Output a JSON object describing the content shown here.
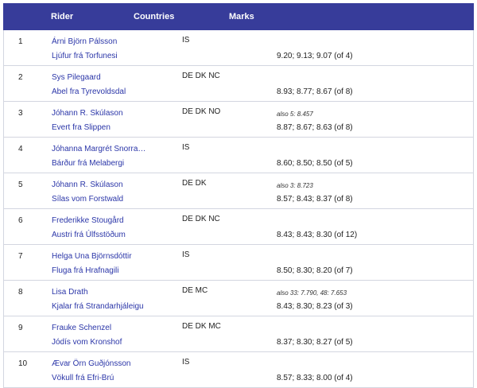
{
  "header": {
    "rider": "Rider",
    "countries": "Countries",
    "marks": "Marks"
  },
  "rows": [
    {
      "rank": "1",
      "rider": "Árni Björn Pálsson",
      "horse": "Ljúfur frá Torfunesi",
      "countries": "IS",
      "note": "",
      "marks": "9.20; 9.13; 9.07 (of 4)"
    },
    {
      "rank": "2",
      "rider": "Sys Pilegaard",
      "horse": "Abel fra Tyrevoldsdal",
      "countries": "DE DK NC",
      "note": "",
      "marks": "8.93; 8.77; 8.67 (of 8)"
    },
    {
      "rank": "3",
      "rider": "Jóhann R. Skúlason",
      "horse": "Evert fra Slippen",
      "countries": "DE DK NO",
      "note": "also 5: 8.457",
      "marks": "8.87; 8.67; 8.63 (of 8)"
    },
    {
      "rank": "4",
      "rider": "Jóhanna Margrét Snorra…",
      "horse": "Bárður frá Melabergi",
      "countries": "IS",
      "note": "",
      "marks": "8.60; 8.50; 8.50 (of 5)"
    },
    {
      "rank": "5",
      "rider": "Jóhann R. Skúlason",
      "horse": "Sílas vom Forstwald",
      "countries": "DE DK",
      "note": "also 3: 8.723",
      "marks": "8.57; 8.43; 8.37 (of 8)"
    },
    {
      "rank": "6",
      "rider": "Frederikke Stougård",
      "horse": "Austri frá Úlfsstöðum",
      "countries": "DE DK NC",
      "note": "",
      "marks": "8.43; 8.43; 8.30 (of 12)"
    },
    {
      "rank": "7",
      "rider": "Helga Una Björnsdóttir",
      "horse": "Fluga frá Hrafnagili",
      "countries": "IS",
      "note": "",
      "marks": "8.50; 8.30; 8.20 (of 7)"
    },
    {
      "rank": "8",
      "rider": "Lisa Drath",
      "horse": "Kjalar frá Strandarhjáleigu",
      "countries": "DE MC",
      "note": "also 33: 7.790, 48: 7.653",
      "marks": "8.43; 8.30; 8.23 (of 3)"
    },
    {
      "rank": "9",
      "rider": "Frauke Schenzel",
      "horse": "Jódís vom Kronshof",
      "countries": "DE DK MC",
      "note": "",
      "marks": "8.37; 8.30; 8.27 (of 5)"
    },
    {
      "rank": "10",
      "rider": "Ævar Örn Guðjónsson",
      "horse": "Vökull frá Efri-Brú",
      "countries": "IS",
      "note": "",
      "marks": "8.57; 8.33; 8.00 (of 4)"
    }
  ]
}
